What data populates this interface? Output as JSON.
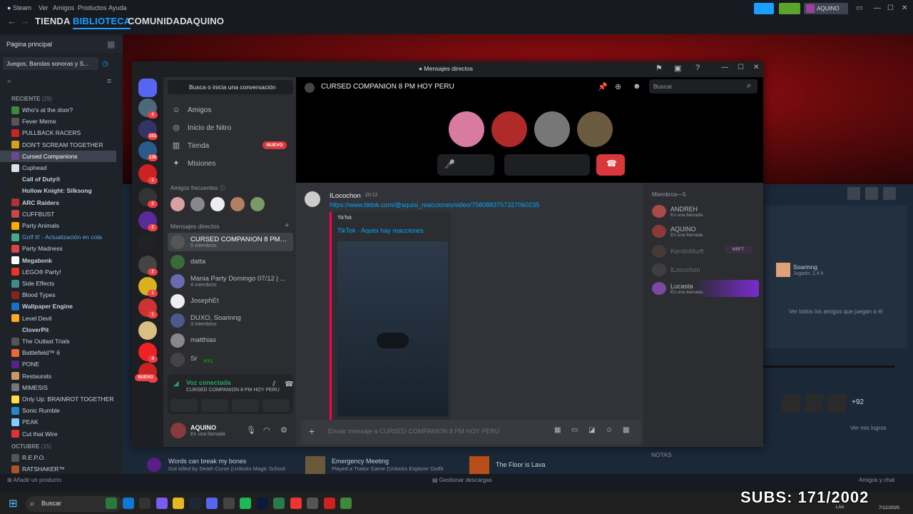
{
  "steam": {
    "menu": [
      "Steam",
      "Ver",
      "Amigos",
      "Productos",
      "Ayuda"
    ],
    "nav": [
      "TIENDA",
      "BIBLIOTECA",
      "COMUNIDAD",
      "AQUINO"
    ],
    "user": "AQUINO",
    "home": "Página principal",
    "filter": "Juegos, Bandas sonoras y S...",
    "recent_header": "RECIENTE",
    "recent_count": "(29)",
    "games": [
      "Who's at the door?",
      "Fever Meme",
      "PULLBACK RACERS",
      "DON'T SCREAM TOGETHER",
      "Cursed Companions",
      "Cuphead",
      "Call of Duty®",
      "Hollow Knight: Silksong",
      "ARC Raiders",
      "CUFFBUST",
      "Party Animals",
      "Golf It! - Actualización en cola",
      "Party Madness",
      "Megabonk",
      "LEGO® Party!",
      "Side Effects",
      "Blood Types",
      "Wallpaper Engine",
      "Level Devil",
      "CloverPit",
      "The Outlast Trials",
      "Battlefield™ 6",
      "PONE",
      "Restaurats",
      "MIMESIS",
      "Only Up: BRAINROT TOGETHER",
      "Sonic Rumble",
      "PEAK",
      "Cut that Wire"
    ],
    "oct_header": "OCTUBRE",
    "oct_count": "(15)",
    "oct_games": [
      "R.E.P.O.",
      "RATSHAKER™"
    ],
    "add_product": "Añadir un producto",
    "downloads": "Gestionar descargas",
    "friends_chat": "Amigos y chat",
    "friend_name": "Soarinng",
    "friend_played": "Jugado: 2,4 h",
    "see_friends": "Ver todos los amigos que juegan a él",
    "achievements_more": "+92",
    "see_achievements": "Ver mis logros",
    "notes": "NOTAS",
    "activity": [
      {
        "title": "Words can break my bones",
        "sub": "Got killed by Death Curse (Unlocks Magic School"
      },
      {
        "title": "Emergency Meeting",
        "sub": "Played a Traitor Game (Unlocks Explorer Outfit"
      },
      {
        "title": "The Floor is Lava",
        "sub": ""
      }
    ]
  },
  "discord": {
    "window_title": "Mensajes directos",
    "search_conv": "Busca o inicia una conversación",
    "nav": [
      "Amigos",
      "Inicio de Nitro",
      "Tienda",
      "Misiones"
    ],
    "new_badge": "NUEVO",
    "frequent": "Amigos frecuentes",
    "dm_header": "Mensajes directos",
    "dms": [
      {
        "name": "CURSED COMPANION 8 PM ...",
        "sub": "5 miembros"
      },
      {
        "name": "datta",
        "sub": ""
      },
      {
        "name": "Mania Party Domingo 07/12 | ...",
        "sub": "4 miembros"
      },
      {
        "name": "JosephEt",
        "sub": ""
      },
      {
        "name": "DUXO, Soarinng",
        "sub": "3 miembros"
      },
      {
        "name": "matthias",
        "sub": ""
      },
      {
        "name": "Sr",
        "sub": ""
      }
    ],
    "tag": "HYL",
    "voice_status": "Voz conectada",
    "voice_channel": "CURSED COMPANION 8 PM HOY PERU",
    "me_name": "AQUINO",
    "me_status": "En una llamada",
    "channel": "CURSED COMPANION 8 PM HOY PERU",
    "search": "Buscar",
    "msg_author": "ILocochon",
    "msg_time": "20:12",
    "msg_link": "https://www.tiktok.com/@aquisi_reacciones/video/7580883757327060235",
    "embed_site": "TikTok",
    "embed_title": "TikTok · Aquisi hay reacciones",
    "input_placeholder": "Enviar mensaje a CURSED COMPANION 8 PM HOY PERU",
    "members_header": "Miembros—5",
    "members": [
      {
        "name": "ANDREH",
        "sub": "En una llamada"
      },
      {
        "name": "AQUINO",
        "sub": "En una llamada"
      },
      {
        "name": "KendoMurft",
        "sub": ""
      },
      {
        "name": "ILocochon",
        "sub": ""
      },
      {
        "name": "Lucasta",
        "sub": "En una llamada"
      }
    ],
    "member_tag": "MRFT",
    "server_badges": [
      "4",
      "101",
      "130",
      "1",
      "2",
      "2",
      "2",
      "1",
      "1",
      "4",
      "9"
    ],
    "server_new": "NUEVO"
  },
  "taskbar": {
    "search": "Buscar",
    "subs": "SUBS: 171/2002",
    "date": "7/12/2025",
    "lang": "LAA"
  }
}
